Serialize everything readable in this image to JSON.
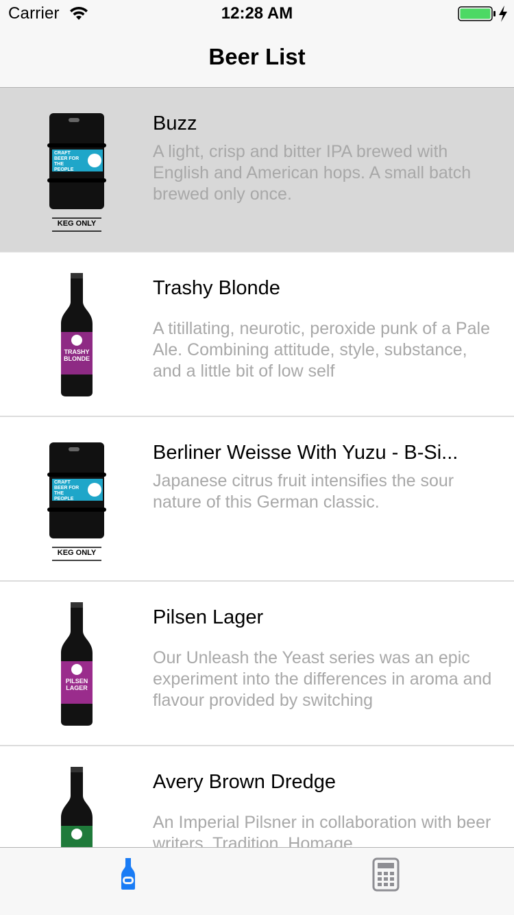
{
  "status": {
    "carrier": "Carrier",
    "time": "12:28 AM",
    "battery_color": "#4cd964"
  },
  "nav": {
    "title": "Beer List"
  },
  "beers": [
    {
      "name": "Buzz",
      "description": "A light, crisp and bitter IPA brewed with English and American hops. A small batch brewed only once.",
      "image": "keg-icon",
      "keg_label": "KEG ONLY",
      "keg_sticker": "CRAFT BEER FOR THE PEOPLE",
      "selected": true
    },
    {
      "name": "Trashy Blonde",
      "description": "A titillating, neurotic, peroxide punk of a Pale Ale. Combining attitude, style, substance, and a little bit of low self",
      "image": "bottle-icon",
      "label_color": "#8e2a84",
      "label_text": "TRASHY BLONDE",
      "selected": false
    },
    {
      "name": "Berliner Weisse With Yuzu - B-Si...",
      "description": "Japanese citrus fruit intensifies the sour nature of this German classic.",
      "image": "keg-icon",
      "keg_label": "KEG ONLY",
      "keg_sticker": "CRAFT BEER FOR THE PEOPLE",
      "selected": false
    },
    {
      "name": "Pilsen Lager",
      "description": "Our Unleash the Yeast series was an epic experiment into the differences in aroma and flavour provided by switching",
      "image": "bottle-icon",
      "label_color": "#9a2c8c",
      "label_text": "PILSEN LAGER",
      "selected": false
    },
    {
      "name": "Avery Brown Dredge",
      "description": "An Imperial Pilsner in collaboration with beer writers. Tradition. Homage.",
      "image": "bottle-icon",
      "label_color": "#1f7a3a",
      "label_text": "",
      "selected": false
    }
  ],
  "tabs": [
    {
      "icon": "beer-bottle-icon",
      "active": true,
      "color": "#1a7cf5"
    },
    {
      "icon": "calculator-icon",
      "active": false,
      "color": "#8e8e93"
    }
  ]
}
